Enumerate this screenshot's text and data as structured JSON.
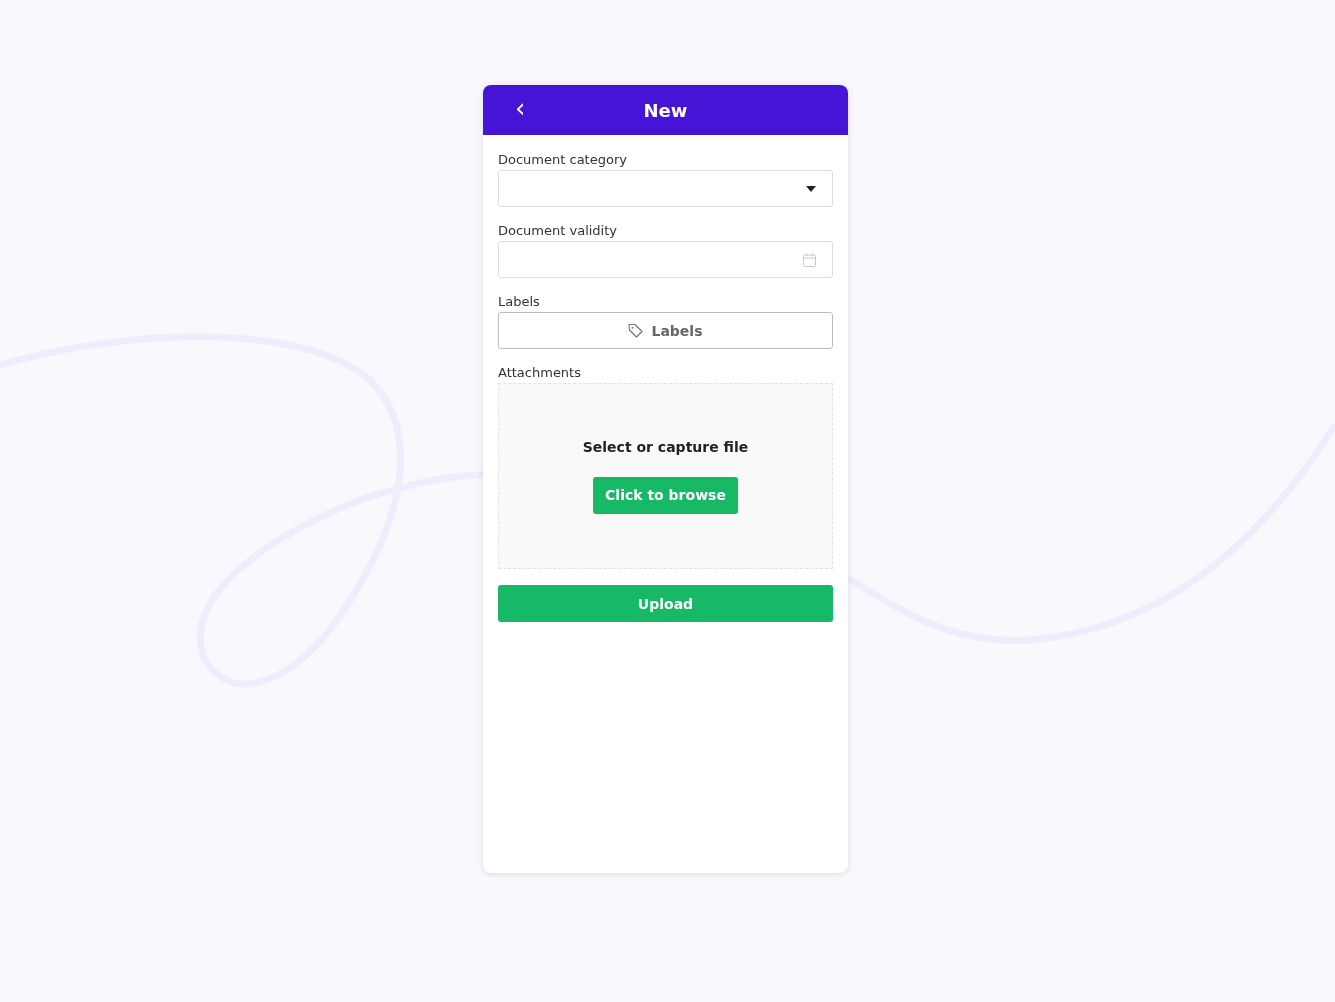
{
  "header": {
    "back_icon": "‹",
    "title": "New"
  },
  "fields": [
    {
      "kind": "select",
      "label": "Document category"
    },
    {
      "kind": "date",
      "label": "Document validity"
    },
    {
      "kind": "button",
      "label": "Labels",
      "button_text": "Labels"
    }
  ],
  "attachments": {
    "label": "Attachments",
    "prompt": "Select or capture file",
    "browse_button": "Click to browse"
  },
  "submit_button": "Upload"
}
